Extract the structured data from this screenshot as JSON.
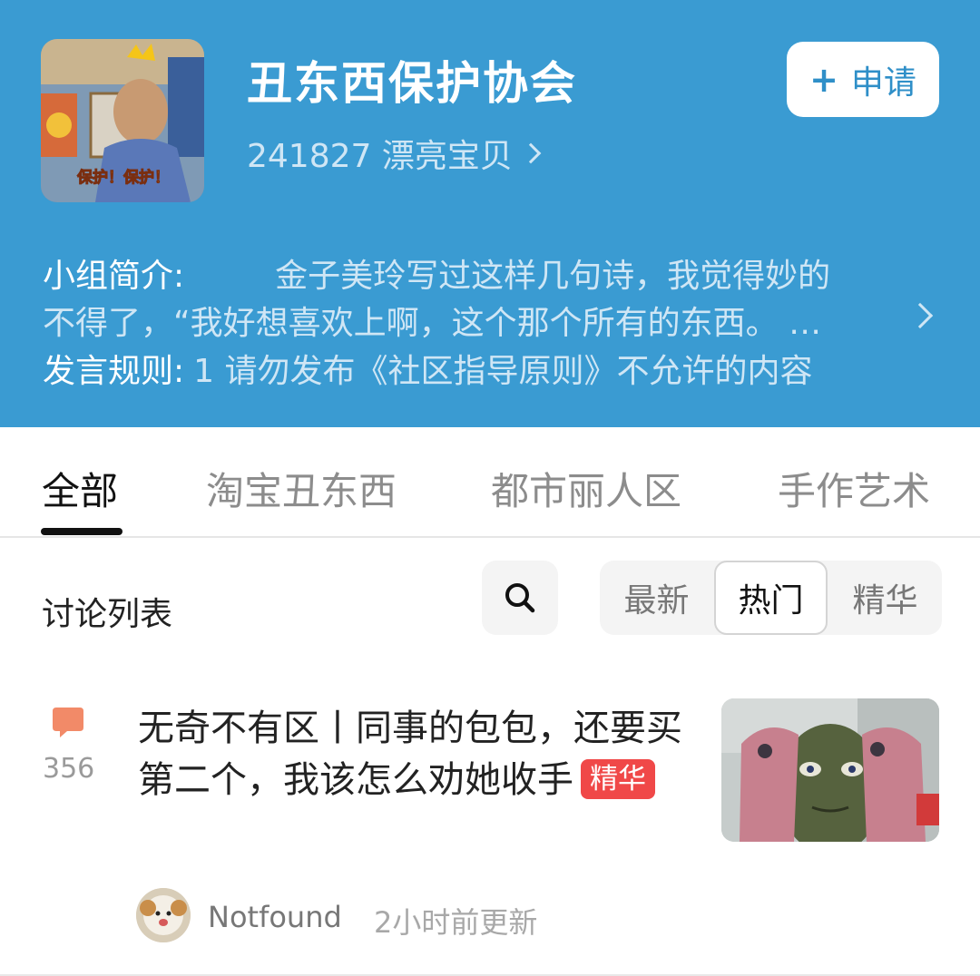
{
  "group": {
    "name": "丑东西保护协会",
    "member_line": "241827 漂亮宝贝",
    "apply_label": "申请",
    "avatar_caption": "保护！保护！",
    "intro_label": "小组简介:",
    "intro_text_1": "金子美玲写过这样几句诗，我觉得妙的",
    "intro_text_2": "不得了，“我好想喜欢上啊，这个那个所有的东西。 …",
    "rules_label": "发言规则:",
    "rules_text": "1 请勿发布《社区指导原则》不允许的内容"
  },
  "tabs": [
    {
      "label": "全部",
      "active": true
    },
    {
      "label": "淘宝丑东西",
      "active": false
    },
    {
      "label": "都市丽人区",
      "active": false
    },
    {
      "label": "手作艺术",
      "active": false
    }
  ],
  "list": {
    "title": "讨论列表",
    "sort_options": [
      "最新",
      "热门",
      "精华"
    ],
    "selected_sort": "热门"
  },
  "post": {
    "comment_count": "356",
    "title": "无奇不有区丨同事的包包，还要买第二个，我该怎么劝她收手",
    "badge": "精华",
    "author": "Notfound",
    "time": "2小时前更新"
  },
  "colors": {
    "header_bg": "#3a9bd2",
    "badge_red": "#f04848",
    "comment_icon": "#f28a68",
    "apply_text": "#2f8fc8"
  },
  "icons": [
    "plus-icon",
    "chevron-right-icon",
    "search-icon",
    "comment-icon"
  ]
}
